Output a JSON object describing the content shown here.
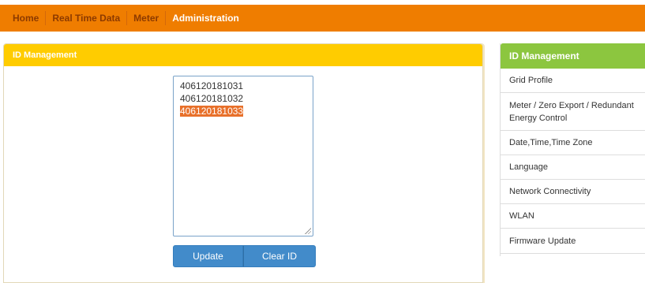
{
  "nav": {
    "items": [
      "Home",
      "Real Time Data",
      "Meter",
      "Administration"
    ]
  },
  "left_panel": {
    "title": "ID Management",
    "ids": [
      "406120181031",
      "406120181032",
      "406120181033"
    ],
    "selected_index": 2,
    "buttons": {
      "update": "Update",
      "clear": "Clear ID"
    }
  },
  "right_panel": {
    "title": "ID Management",
    "items": [
      "Grid Profile",
      "Meter / Zero Export / Redundant Energy Control",
      "Date,Time,Time Zone",
      "Language",
      "Network Connectivity",
      "WLAN",
      "Firmware Update"
    ]
  },
  "colors": {
    "topbar": "#ef7d00",
    "left_header": "#ffcc00",
    "right_header": "#8cc63f",
    "button": "#428bca",
    "selection": "#e8702a"
  }
}
